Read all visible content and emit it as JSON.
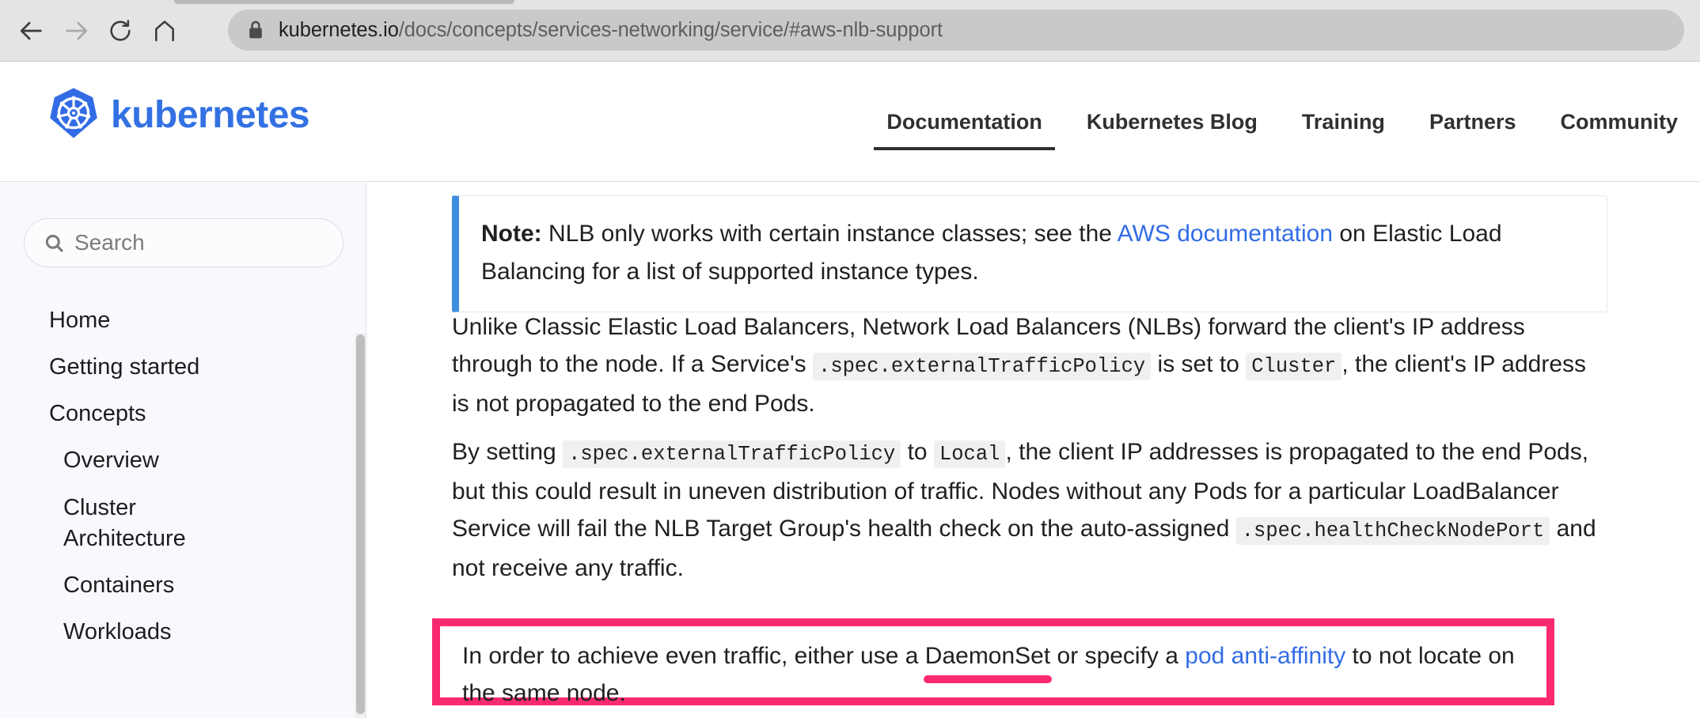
{
  "browser": {
    "back_icon": "back-arrow-icon",
    "forward_icon": "forward-arrow-icon",
    "reload_icon": "reload-icon",
    "home_icon": "home-icon",
    "lock_icon": "lock-icon",
    "url_host": "kubernetes.io",
    "url_path": "/docs/concepts/services-networking/service/#aws-nlb-support",
    "url_full": "kubernetes.io/docs/concepts/services-networking/service/#aws-nlb-support"
  },
  "header": {
    "brand_text": "kubernetes",
    "logo_icon": "kubernetes-helm-logo-icon",
    "brand_color": "#3371e3",
    "nav": [
      {
        "label": "Documentation",
        "active": true
      },
      {
        "label": "Kubernetes Blog",
        "active": false
      },
      {
        "label": "Training",
        "active": false
      },
      {
        "label": "Partners",
        "active": false
      },
      {
        "label": "Community",
        "active": false
      }
    ]
  },
  "sidebar": {
    "search": {
      "placeholder": "Search",
      "icon": "search-icon",
      "value": ""
    },
    "items": [
      {
        "label": "Home",
        "level": 1
      },
      {
        "label": "Getting started",
        "level": 1
      },
      {
        "label": "Concepts",
        "level": 1
      },
      {
        "label": "Overview",
        "level": 2
      },
      {
        "label": "Cluster\nArchitecture",
        "level": 2
      },
      {
        "label": "Containers",
        "level": 2
      },
      {
        "label": "Workloads",
        "level": 2
      }
    ]
  },
  "content": {
    "note": {
      "label": "Note:",
      "text_before_link": " NLB only works with certain instance classes; see the ",
      "link_text": "AWS documentation",
      "text_after_link": " on Elastic Load Balancing for a list of supported instance types.",
      "accent_color": "#3f8fe0"
    },
    "paragraph1": {
      "seg1": "Unlike Classic Elastic Load Balancers, Network Load Balancers (NLBs) forward the client's IP address through to the node. If a Service's ",
      "code1": ".spec.externalTrafficPolicy",
      "seg2": " is set to ",
      "code2": "Cluster",
      "seg3": ", the client's IP address is not propagated to the end Pods."
    },
    "paragraph2": {
      "seg1": "By setting ",
      "code1": ".spec.externalTrafficPolicy",
      "seg2": " to ",
      "code2": "Local",
      "seg3": ", the client IP addresses is propagated to the end Pods, but this could result in uneven distribution of traffic. Nodes without any Pods for a particular LoadBalancer Service will fail the NLB Target Group's health check on the auto-assigned ",
      "code3": ".spec.healthCheckNodePort",
      "seg4": " and not receive any traffic."
    },
    "highlighted": {
      "seg1": "In order to achieve even traffic, either use a ",
      "underlined_term": "DaemonSet",
      "seg2": " or specify a ",
      "link_text": "pod anti-affinity",
      "seg3": " to not locate on the same node.",
      "highlight_color": "#fa2a6f",
      "link_color": "#326ce5"
    }
  }
}
